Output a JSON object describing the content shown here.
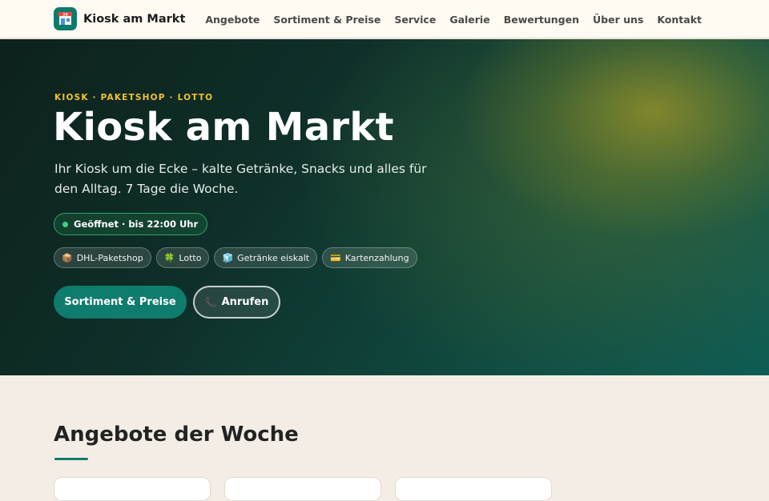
{
  "header": {
    "brand": "Kiosk am Markt",
    "logo_icon": "kiosk-shop-icon",
    "nav": [
      "Angebote",
      "Sortiment & Preise",
      "Service",
      "Galerie",
      "Bewertungen",
      "Über uns",
      "Kontakt"
    ]
  },
  "hero": {
    "eyebrow": "KIOSK · PAKETSHOP · LOTTO",
    "title": "Kiosk am Markt",
    "subtitle": "Ihr Kiosk um die Ecke – kalte Getränke, Snacks und alles für den Alltag. 7 Tage die Woche.",
    "status": "Geöffnet · bis 22:00 Uhr",
    "chips": [
      {
        "icon": "📦",
        "label": "DHL-Paketshop"
      },
      {
        "icon": "🍀",
        "label": "Lotto"
      },
      {
        "icon": "🧊",
        "label": "Getränke eiskalt"
      },
      {
        "icon": "💳",
        "label": "Kartenzahlung"
      }
    ],
    "primary_button": "Sortiment & Preise",
    "secondary_button": "Anrufen",
    "secondary_button_icon": "📞"
  },
  "offers": {
    "title": "Angebote der Woche"
  },
  "colors": {
    "accent": "#0f7c6d",
    "eyebrow": "#f2c230",
    "status_green": "#3fd07d"
  }
}
